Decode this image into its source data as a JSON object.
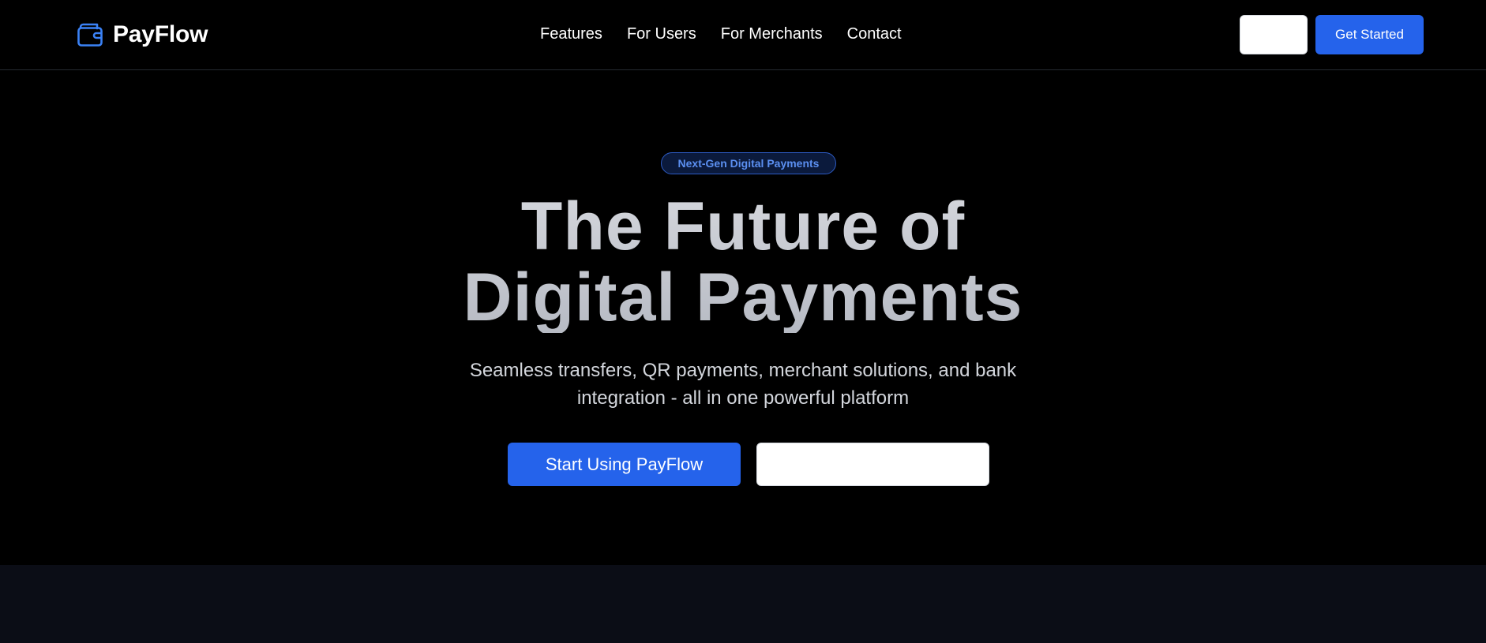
{
  "brand": {
    "name": "PayFlow",
    "icon": "wallet-icon",
    "accent_color": "#2563eb"
  },
  "nav": {
    "links": [
      "Features",
      "For Users",
      "For Merchants",
      "Contact"
    ],
    "signin_label": "",
    "get_started_label": "Get Started"
  },
  "hero": {
    "badge": "Next-Gen Digital Payments",
    "title_line1": "The Future of",
    "title_line2": "Digital Payments",
    "subtitle": "Seamless transfers, QR payments, merchant solutions, and bank integration - all in one powerful platform",
    "primary_cta": "Start Using PayFlow",
    "secondary_cta": ""
  },
  "colors": {
    "background": "#000000",
    "next_section_background": "#0b0d16",
    "primary_button": "#2563eb",
    "badge_text": "#5b8ff0"
  }
}
